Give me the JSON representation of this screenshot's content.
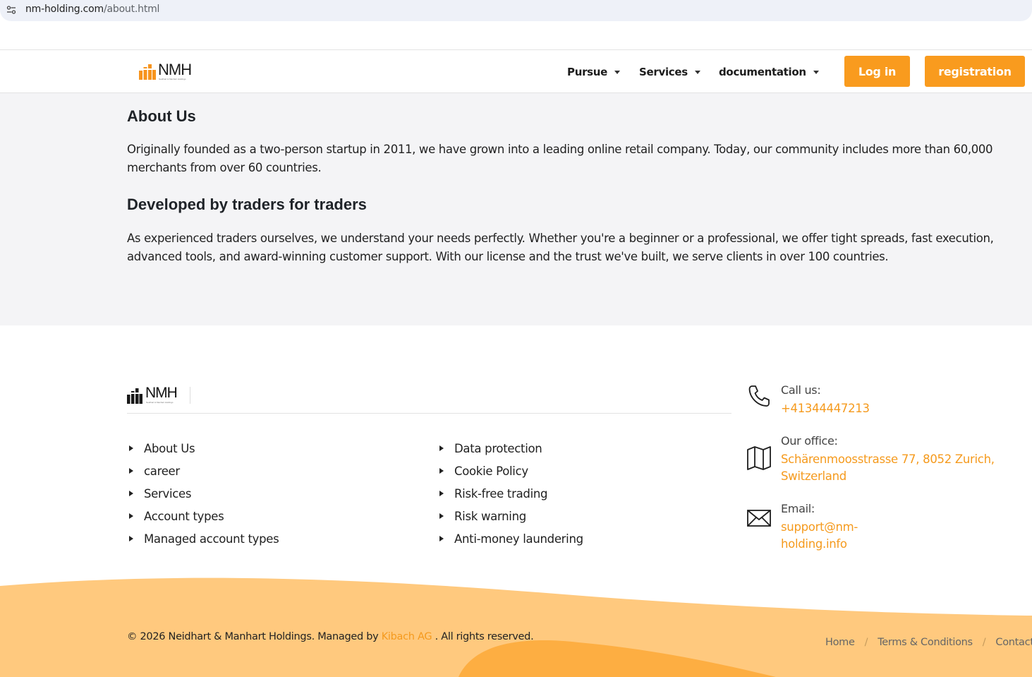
{
  "browser": {
    "url_host": "nm-holding.com",
    "url_path": "/about.html"
  },
  "header": {
    "logo_text": "NMH",
    "logo_tagline": "Neidhart & Manhart Holdings",
    "nav": [
      {
        "label": "Pursue"
      },
      {
        "label": "Services"
      },
      {
        "label": "documentation"
      }
    ],
    "login_label": "Log in",
    "register_label": "registration"
  },
  "about": {
    "title": "About Us",
    "paragraph1": "Originally founded as a two-person startup in 2011, we have grown into a leading online retail company. Today, our community includes more than 60,000 merchants from over 60 countries.",
    "subtitle": "Developed by traders for traders",
    "paragraph2": "As experienced traders ourselves, we understand your needs perfectly. Whether you're a beginner or a professional, we offer tight spreads, fast execution, advanced tools, and award-winning customer support. With our license and the trust we've built, we serve clients in over 100 countries."
  },
  "footer": {
    "logo_text": "NMH",
    "logo_tagline": "Neidhart & Manhart Holdings",
    "links_col1": [
      "About Us",
      "career",
      "Services",
      "Account types",
      "Managed account types"
    ],
    "links_col2": [
      "Data protection",
      "Cookie Policy",
      "Risk-free trading",
      "Risk warning",
      "Anti-money laundering"
    ],
    "contact": {
      "phone_label": "Call us:",
      "phone_value": "+41344447213",
      "office_label": "Our office:",
      "office_value": "Schärenmoosstrasse 77, 8052 Zurich, Switzerland",
      "email_label": "Email:",
      "email_value": "support@nm-holding.info"
    },
    "copyright_prefix": "© 2026 Neidhart & Manhart Holdings. Managed by",
    "copyright_brand": "Kibach AG",
    "copyright_suffix": ". All rights reserved.",
    "bottom_nav": [
      "Home",
      "Terms & Conditions",
      "Contacts"
    ]
  },
  "colors": {
    "accent": "#f99b1e",
    "wave_light": "#ffc97e",
    "wave_dark": "#fdae42"
  }
}
